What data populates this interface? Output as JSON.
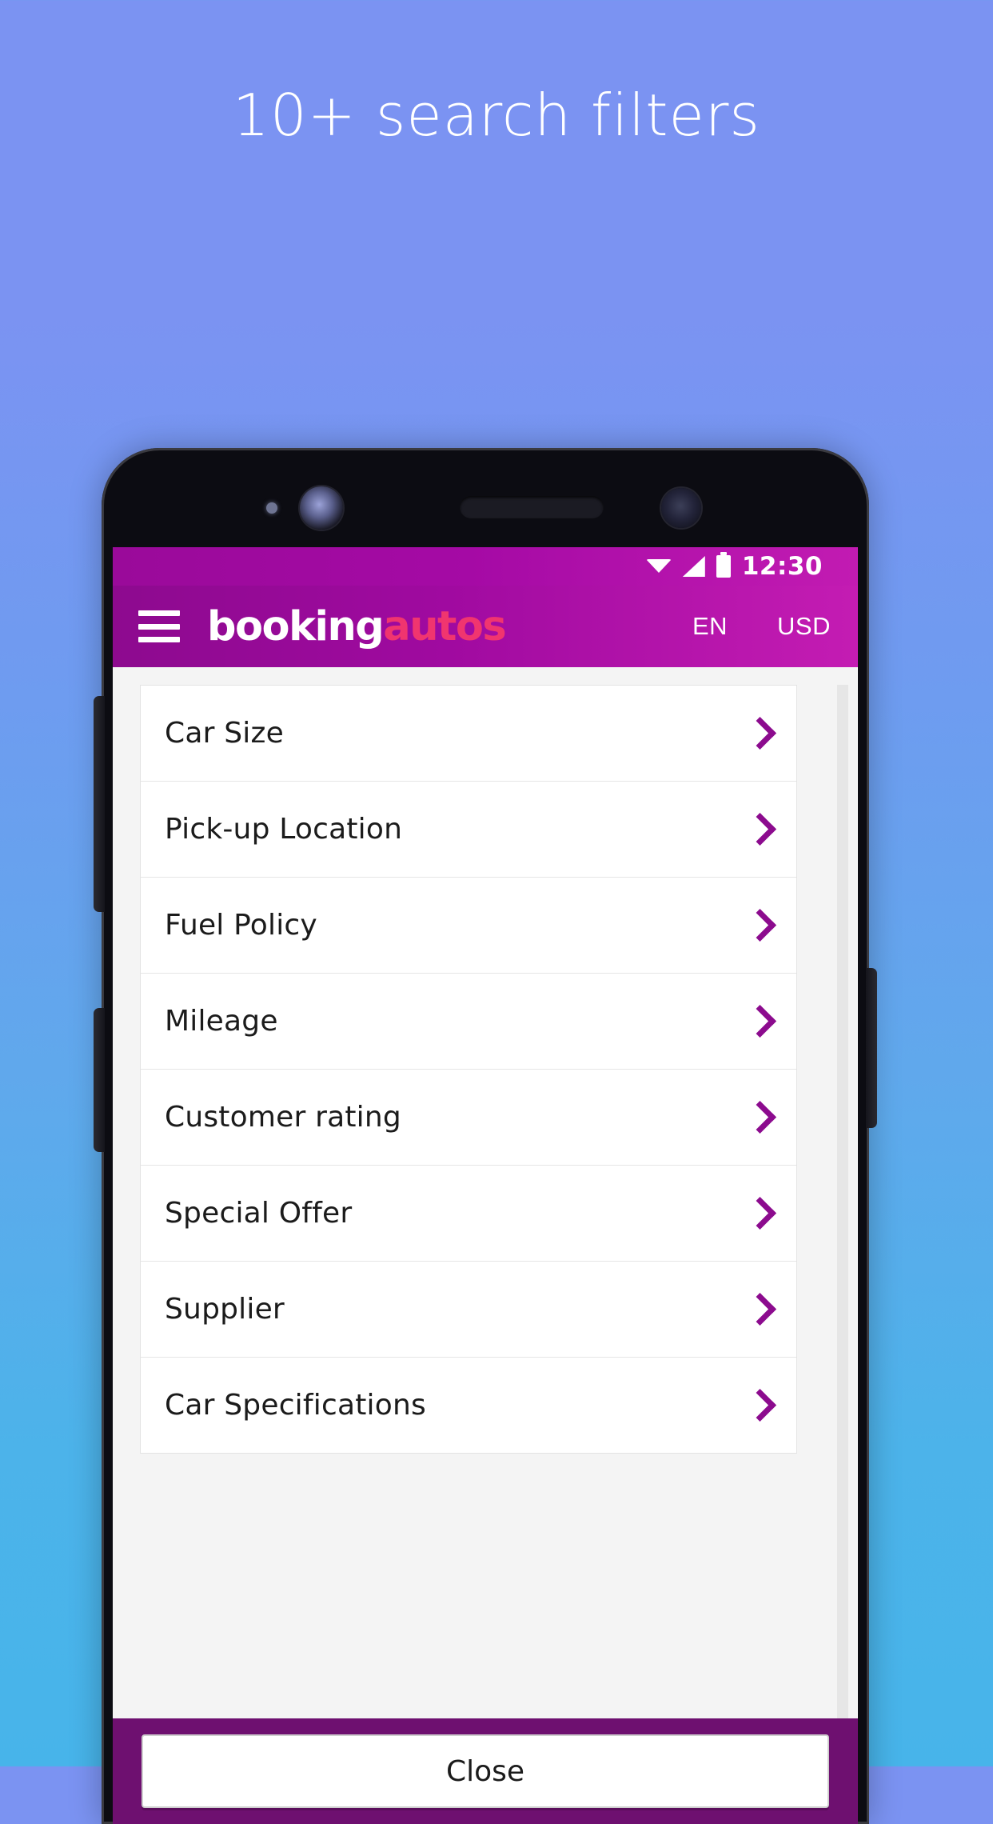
{
  "promo": {
    "headline": "10+ search filters"
  },
  "device": {
    "status_bar": {
      "wifi_icon": "wifi-icon",
      "signal_icon": "signal-icon",
      "battery_icon": "battery-icon",
      "time": "12:30"
    },
    "hardware": {
      "sensor_icon": "proximity-sensor",
      "front_camera_icon": "front-camera",
      "speaker_icon": "earpiece-speaker",
      "secondary_camera_icon": "secondary-camera",
      "volume_up_button": "volume-up",
      "volume_down_button": "volume-down",
      "power_button": "power"
    }
  },
  "app": {
    "appbar": {
      "menu_icon": "hamburger-menu-icon",
      "logo_primary": "booking",
      "logo_accent": "autos",
      "language": "EN",
      "currency": "USD",
      "bg_color": "#a00aa0",
      "accent_color": "#f0356f"
    },
    "filters": {
      "chevron_color": "#8c0b8e",
      "items": [
        {
          "label": "Car Size",
          "chevron_icon": "chevron-right-icon"
        },
        {
          "label": "Pick-up Location",
          "chevron_icon": "chevron-right-icon"
        },
        {
          "label": "Fuel Policy",
          "chevron_icon": "chevron-right-icon"
        },
        {
          "label": "Mileage",
          "chevron_icon": "chevron-right-icon"
        },
        {
          "label": "Customer rating",
          "chevron_icon": "chevron-right-icon"
        },
        {
          "label": "Special Offer",
          "chevron_icon": "chevron-right-icon"
        },
        {
          "label": "Supplier",
          "chevron_icon": "chevron-right-icon"
        },
        {
          "label": "Car Specifications",
          "chevron_icon": "chevron-right-icon"
        }
      ]
    },
    "footer": {
      "close_label": "Close",
      "bg_color": "#6e1070"
    }
  }
}
